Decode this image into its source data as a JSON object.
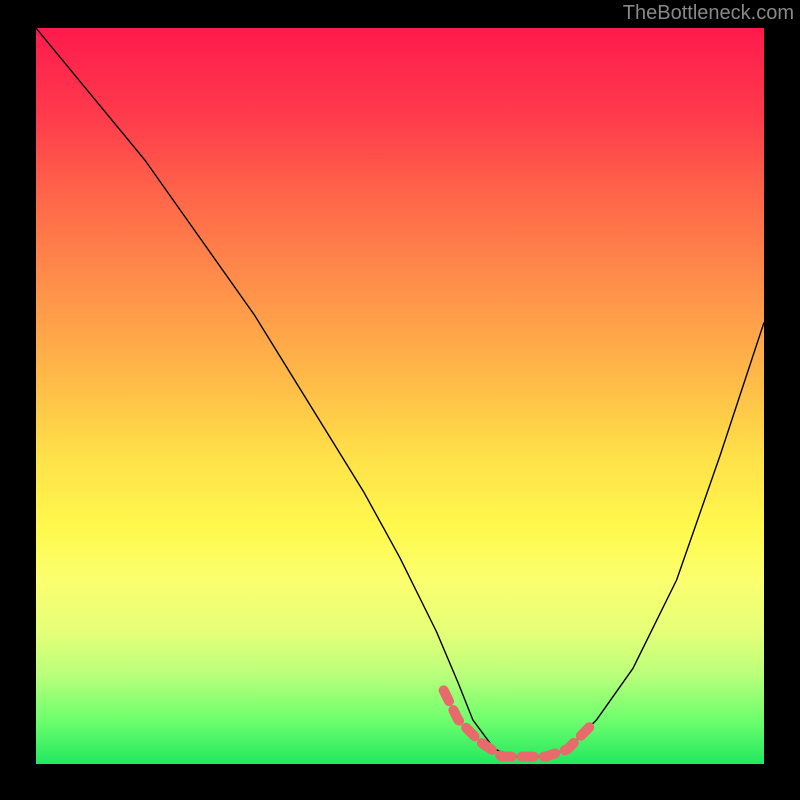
{
  "watermark": {
    "text": "TheBottleneck.com"
  },
  "chart_data": {
    "type": "line",
    "title": "",
    "xlabel": "",
    "ylabel": "",
    "xlim": [
      0,
      100
    ],
    "ylim": [
      0,
      100
    ],
    "series": [
      {
        "name": "bottleneck-curve",
        "x": [
          0,
          5,
          10,
          15,
          20,
          25,
          30,
          35,
          40,
          45,
          50,
          55,
          58,
          60,
          63,
          66,
          70,
          73,
          77,
          82,
          88,
          94,
          100
        ],
        "y": [
          100,
          94,
          88,
          82,
          75,
          68,
          61,
          53,
          45,
          37,
          28,
          18,
          11,
          6,
          2,
          1,
          1,
          2,
          6,
          13,
          25,
          42,
          60
        ]
      }
    ],
    "highlight": {
      "name": "optimal-range",
      "x": [
        56,
        58,
        61,
        64,
        67,
        70,
        73,
        76
      ],
      "y": [
        10,
        6,
        3,
        1,
        1,
        1,
        2,
        5
      ]
    }
  }
}
